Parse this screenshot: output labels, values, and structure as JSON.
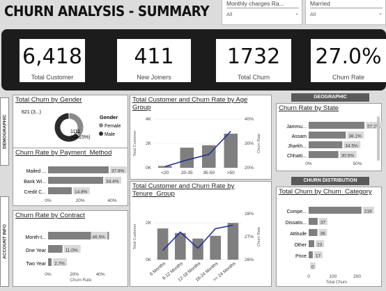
{
  "header": {
    "title": "CHURN ANALYSIS - SUMMARY"
  },
  "slicers": [
    {
      "label": "Monthly charges Ra...",
      "value": "All"
    },
    {
      "label": "Married",
      "value": "All"
    }
  ],
  "kpis": [
    {
      "value": "6,418",
      "label": "Total Customer"
    },
    {
      "value": "411",
      "label": "New Joiners"
    },
    {
      "value": "1732",
      "label": "Total Churn"
    },
    {
      "value": "27.0%",
      "label": "Churn Rate"
    }
  ],
  "side_labels": {
    "demographic": "DEMOGRAPHIC",
    "account": "ACCOUNT INFO"
  },
  "bands": {
    "geographic": "GEOGRAPHIC",
    "distribution": "CHURN DISTRIBUTION"
  },
  "colors": {
    "bar": "#7f7f7f",
    "line": "#1f2f99",
    "dark": "#1c1c1c",
    "label_bg": "#d9d9d9",
    "donut_dark": "#2b2b2b",
    "donut_light": "#8a8a8a"
  },
  "panels": {
    "gender": {
      "title": "Total Churn by Gender"
    },
    "payment": {
      "title": "Churn Rate by Payment_Method"
    },
    "contract": {
      "title": "Churn Rate by Contract"
    },
    "age": {
      "title_line1": "Total Customer and Churn Rate by Age",
      "title_line2": "Group"
    },
    "tenure": {
      "title_line1": "Total Customer and Churn Rate by",
      "title_line2": "Tenure_Group"
    },
    "state": {
      "title": "Churn Rate by State"
    },
    "category": {
      "title": "Total Churn by Churn_Category"
    }
  },
  "chart_data": [
    {
      "id": "gender",
      "type": "pie",
      "legend_title": "Gender",
      "categories": [
        "Female",
        "Male"
      ],
      "values": [
        621,
        1111
      ],
      "data_labels": [
        "621 (3...)",
        "1111 (64.15%)"
      ]
    },
    {
      "id": "payment",
      "type": "bar",
      "orientation": "horizontal",
      "categories": [
        "Mailed ...",
        "Bank Wi...",
        "Credit C..."
      ],
      "values": [
        37.8,
        34.4,
        14.8
      ],
      "value_labels": [
        "37.8%",
        "34.4%",
        "14.8%"
      ],
      "xlim": [
        0,
        40
      ],
      "ticks": [
        "0%",
        "20%",
        "40%"
      ]
    },
    {
      "id": "contract",
      "type": "bar",
      "orientation": "horizontal",
      "categories": [
        "Month-t...",
        "One Year",
        "Two Year"
      ],
      "values": [
        46.5,
        11.0,
        2.7
      ],
      "value_labels": [
        "46.5%",
        "11.0%",
        "2.7%"
      ],
      "xlim": [
        0,
        50
      ],
      "ticks": [
        "0%",
        "20%",
        "40%"
      ],
      "xlabel": "Churn Rate"
    },
    {
      "id": "age",
      "type": "bar",
      "categories": [
        "<20",
        "20-35",
        "35-50",
        ">50"
      ],
      "series": [
        {
          "name": "Total Customer",
          "values": [
            150,
            1650,
            1850,
            2800
          ]
        },
        {
          "name": "Churn Rate",
          "type": "line",
          "values": [
            20.5,
            23.2,
            25.5,
            35.0
          ]
        }
      ],
      "ylim": [
        0,
        4000
      ],
      "y_ticks": [
        "0K",
        "2K",
        "4K"
      ],
      "y2lim": [
        20,
        40
      ],
      "y2_ticks": [
        "20%",
        "30%",
        "40%"
      ],
      "ylabel": "Total Customer",
      "y2label": "Churn Rate"
    },
    {
      "id": "tenure",
      "type": "bar",
      "categories": [
        "6 Months",
        "6-12 Months",
        "12-18 Months",
        "18-24 Months",
        ">= 24 Months"
      ],
      "series": [
        {
          "name": "Total Customer",
          "values": [
            1700,
            1450,
            1150,
            1300,
            2000
          ]
        },
        {
          "name": "Churn Rate",
          "type": "line",
          "values": [
            26.4,
            27.2,
            26.5,
            27.35,
            27.5
          ]
        }
      ],
      "ylim": [
        0,
        2500
      ],
      "y_ticks": [
        "0K",
        "2K"
      ],
      "y2lim": [
        26,
        28
      ],
      "y2_ticks": [
        "26%",
        "27%",
        "28%"
      ],
      "ylabel": "Total Customer",
      "y2label": "Churn Rate"
    },
    {
      "id": "state",
      "type": "bar",
      "orientation": "horizontal",
      "categories": [
        "Jammu...",
        "Assam",
        "Jharkh...",
        "Chhatti..."
      ],
      "values": [
        57.2,
        38.1,
        34.5,
        30.5
      ],
      "value_labels": [
        "57.2%",
        "38.1%",
        "34.5%",
        "30.5%"
      ],
      "xlim": [
        0,
        60
      ],
      "ticks": [
        "0%",
        "50%"
      ]
    },
    {
      "id": "category",
      "type": "bar",
      "orientation": "horizontal",
      "categories": [
        "Compe...",
        "Dissatis...",
        "Attitude",
        "Other",
        "Price",
        ""
      ],
      "values": [
        218,
        37,
        36,
        23,
        17,
        0
      ],
      "value_labels": [
        "218",
        "37",
        "36",
        "23",
        "17",
        "0"
      ],
      "xlim": [
        0,
        230
      ],
      "ticks": [
        "0",
        "100",
        "200"
      ],
      "xlabel": "Total Churn"
    }
  ]
}
